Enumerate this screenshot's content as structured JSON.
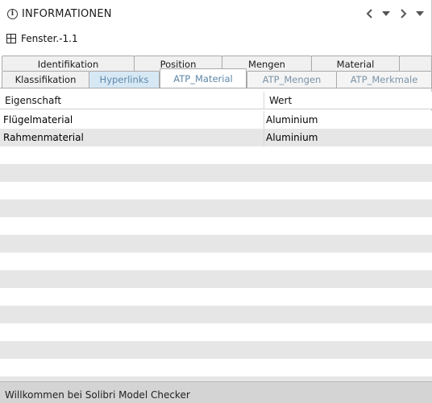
{
  "panel": {
    "title": "INFORMATIONEN",
    "icons": {
      "info": "info-icon",
      "prev": "chevron-left-icon",
      "menu1": "chevron-down-icon",
      "next": "chevron-right-icon",
      "menu2": "chevron-down-icon"
    }
  },
  "object": {
    "name": "Fenster.-1.1",
    "icon": "window-icon"
  },
  "tabs": {
    "row1": [
      "Identifikation",
      "Position",
      "Mengen",
      "Material"
    ],
    "row2": [
      "Klassifikation",
      "Hyperlinks",
      "ATP_Material",
      "ATP_Mengen",
      "ATP_Merkmale"
    ],
    "active": "ATP_Material"
  },
  "table": {
    "columns": [
      "Eigenschaft",
      "Wert"
    ],
    "rows": [
      [
        "Flügelmaterial",
        "Aluminium"
      ],
      [
        "Rahmenmaterial",
        "Aluminium"
      ]
    ]
  },
  "status": {
    "text": "Willkommen bei Solibri Model Checker"
  },
  "colors": {
    "tab_active_text": "#5e87a8",
    "tab_highlight_bg": "#d7e8f5",
    "row_stripe": "#e6e6e6",
    "statusbar_bg": "#d4d4d4"
  }
}
